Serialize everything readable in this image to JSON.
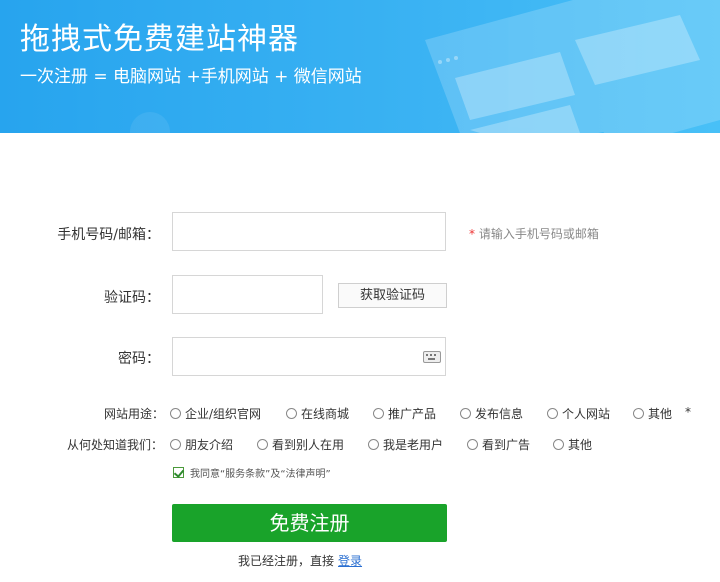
{
  "banner": {
    "title": "拖拽式免费建站神器",
    "subtitle": "一次注册 = 电脑网站 +手机网站 + 微信网站",
    "background": "#2aa6ef"
  },
  "form": {
    "phone_label": "手机号码/邮箱：",
    "phone_hint_star": "*",
    "phone_hint": "请输入手机号码或邮箱",
    "phone_value": "",
    "code_label": "验证码：",
    "code_value": "",
    "get_code_button": "获取验证码",
    "password_label": "密码：",
    "password_value": "",
    "password_icon": "keyboard-icon"
  },
  "purpose": {
    "label": "网站用途：",
    "required_star": "*",
    "options": [
      "企业/组织官网",
      "在线商城",
      "推广产品",
      "发布信息",
      "个人网站",
      "其他"
    ]
  },
  "source": {
    "label": "从何处知道我们：",
    "options": [
      "朋友介绍",
      "看到别人在用",
      "我是老用户",
      "看到广告",
      "其他"
    ]
  },
  "agreement": {
    "text": "我同意“服务条款”及“法律声明”",
    "checked": true
  },
  "submit_label": "免费注册",
  "login": {
    "prefix": "我已经注册，直接",
    "link": "登录"
  },
  "colors": {
    "accent_green": "#19a32a",
    "link_blue": "#2a6fd1",
    "required_red": "#e33333"
  }
}
